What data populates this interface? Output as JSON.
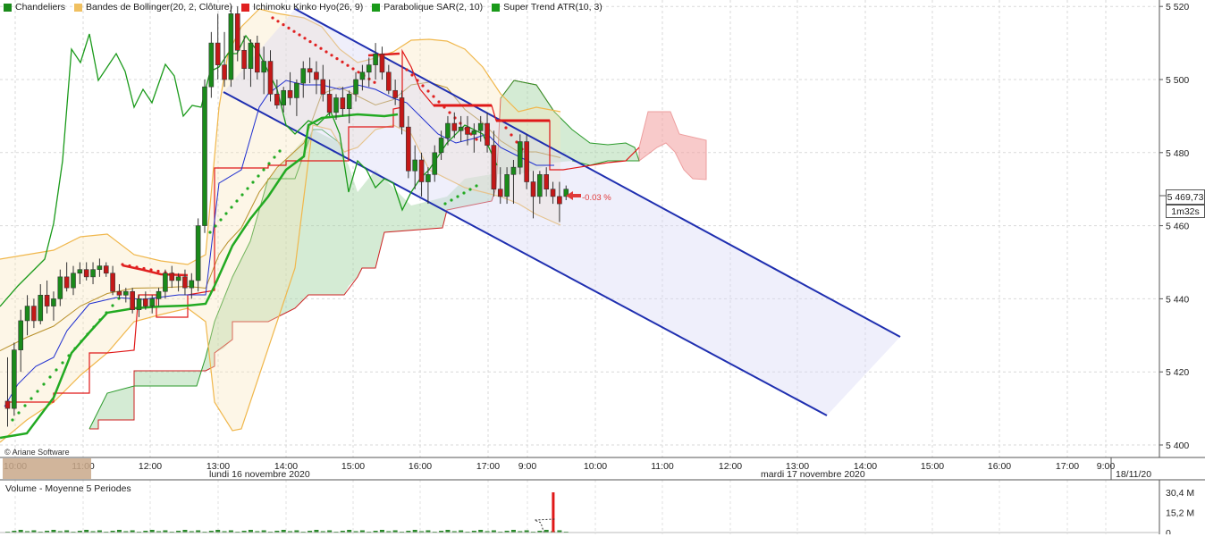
{
  "legend": [
    {
      "label": "Chandeliers",
      "color": "#1a8a1a"
    },
    {
      "label": "Bandes de Bollinger(20, 2, Clôture)",
      "color": "#f0c060"
    },
    {
      "label": "Ichimoku Kinko Hyo(26, 9)",
      "color": "#e02020"
    },
    {
      "label": "Parabolique SAR(2, 10)",
      "color": "#1a9a1a"
    },
    {
      "label": "Super Trend ATR(10, 3)",
      "color": "#1a9a1a"
    }
  ],
  "copyright": "© Ariane Software",
  "volume_title": "Volume  - Moyenne 5 Periodes",
  "last_price_box": "5 469,73",
  "timer_box": "1m32s",
  "change_label": "-0.03 %",
  "date_labels": {
    "day1": "lundi 16 novembre 2020",
    "day2": "mardi 17 novembre 2020",
    "day3": "18/11/20"
  },
  "chart_data": {
    "type": "candlestick",
    "y_axis": {
      "range": [
        5395,
        5525
      ],
      "ticks": [
        "5 400",
        "5 420",
        "5 440",
        "5 460",
        "5 480",
        "5 500",
        "5 520"
      ]
    },
    "x_ticks": [
      "10:00",
      "11:00",
      "12:00",
      "13:00",
      "14:00",
      "15:00",
      "16:00",
      "17:00",
      "9:00",
      "10:00",
      "11:00",
      "12:00",
      "13:00",
      "14:00",
      "15:00",
      "16:00",
      "17:00",
      "9:00"
    ],
    "volume_axis": {
      "ticks": [
        "30,4 M",
        "15,2 M",
        "0"
      ],
      "range": [
        0,
        30.4
      ]
    },
    "candles": [
      [
        5412,
        5424,
        5405,
        5410
      ],
      [
        5410,
        5428,
        5408,
        5426
      ],
      [
        5426,
        5437,
        5420,
        5434
      ],
      [
        5434,
        5441,
        5430,
        5438
      ],
      [
        5438,
        5440,
        5432,
        5434
      ],
      [
        5434,
        5444,
        5433,
        5441
      ],
      [
        5441,
        5445,
        5436,
        5438
      ],
      [
        5438,
        5442,
        5434,
        5440
      ],
      [
        5440,
        5448,
        5438,
        5446
      ],
      [
        5446,
        5450,
        5442,
        5443
      ],
      [
        5443,
        5449,
        5441,
        5447
      ],
      [
        5447,
        5450,
        5444,
        5448
      ],
      [
        5448,
        5450,
        5445,
        5446
      ],
      [
        5446,
        5450,
        5444,
        5448
      ],
      [
        5448,
        5451,
        5446,
        5449
      ],
      [
        5449,
        5450,
        5446,
        5447
      ],
      [
        5447,
        5449,
        5441,
        5442
      ],
      [
        5442,
        5444,
        5440,
        5441
      ],
      [
        5441,
        5443,
        5439,
        5442
      ],
      [
        5442,
        5443,
        5436,
        5437
      ],
      [
        5437,
        5441,
        5435,
        5440
      ],
      [
        5440,
        5442,
        5437,
        5438
      ],
      [
        5438,
        5441,
        5436,
        5440
      ],
      [
        5440,
        5443,
        5438,
        5442
      ],
      [
        5442,
        5448,
        5440,
        5447
      ],
      [
        5447,
        5449,
        5443,
        5445
      ],
      [
        5445,
        5447,
        5442,
        5446
      ],
      [
        5446,
        5448,
        5441,
        5443
      ],
      [
        5443,
        5447,
        5440,
        5445
      ],
      [
        5445,
        5462,
        5442,
        5460
      ],
      [
        5460,
        5500,
        5458,
        5498
      ],
      [
        5498,
        5513,
        5495,
        5510
      ],
      [
        5510,
        5518,
        5500,
        5504
      ],
      [
        5504,
        5513,
        5498,
        5500
      ],
      [
        5500,
        5520,
        5498,
        5518
      ],
      [
        5518,
        5520,
        5505,
        5508
      ],
      [
        5508,
        5512,
        5500,
        5503
      ],
      [
        5503,
        5511,
        5498,
        5510
      ],
      [
        5510,
        5512,
        5500,
        5502
      ],
      [
        5502,
        5509,
        5496,
        5505
      ],
      [
        5505,
        5508,
        5494,
        5496
      ],
      [
        5496,
        5500,
        5492,
        5493
      ],
      [
        5493,
        5498,
        5491,
        5497
      ],
      [
        5497,
        5502,
        5493,
        5495
      ],
      [
        5495,
        5500,
        5490,
        5499
      ],
      [
        5499,
        5505,
        5495,
        5503
      ],
      [
        5503,
        5506,
        5499,
        5502
      ],
      [
        5502,
        5505,
        5496,
        5500
      ],
      [
        5500,
        5504,
        5494,
        5496
      ],
      [
        5496,
        5500,
        5490,
        5491
      ],
      [
        5491,
        5496,
        5489,
        5495
      ],
      [
        5495,
        5498,
        5490,
        5492
      ],
      [
        5492,
        5497,
        5488,
        5496
      ],
      [
        5496,
        5502,
        5494,
        5500
      ],
      [
        5500,
        5504,
        5497,
        5502
      ],
      [
        5502,
        5506,
        5498,
        5504
      ],
      [
        5504,
        5510,
        5500,
        5507
      ],
      [
        5507,
        5509,
        5500,
        5502
      ],
      [
        5502,
        5504,
        5496,
        5497
      ],
      [
        5497,
        5500,
        5493,
        5495
      ],
      [
        5495,
        5497,
        5485,
        5487
      ],
      [
        5487,
        5490,
        5473,
        5475
      ],
      [
        5475,
        5482,
        5470,
        5478
      ],
      [
        5478,
        5480,
        5468,
        5472
      ],
      [
        5472,
        5476,
        5466,
        5474
      ],
      [
        5474,
        5482,
        5472,
        5480
      ],
      [
        5480,
        5486,
        5478,
        5484
      ],
      [
        5484,
        5490,
        5482,
        5488
      ],
      [
        5488,
        5491,
        5484,
        5486
      ],
      [
        5486,
        5490,
        5483,
        5487
      ],
      [
        5487,
        5490,
        5482,
        5485
      ],
      [
        5485,
        5488,
        5480,
        5486
      ],
      [
        5486,
        5490,
        5483,
        5488
      ],
      [
        5488,
        5491,
        5480,
        5482
      ],
      [
        5482,
        5486,
        5468,
        5470
      ],
      [
        5470,
        5476,
        5466,
        5468
      ],
      [
        5468,
        5476,
        5466,
        5474
      ],
      [
        5474,
        5478,
        5466,
        5476
      ],
      [
        5476,
        5485,
        5474,
        5483
      ],
      [
        5483,
        5485,
        5470,
        5472
      ],
      [
        5472,
        5475,
        5462,
        5468
      ],
      [
        5468,
        5475,
        5466,
        5474
      ],
      [
        5474,
        5476,
        5468,
        5470
      ],
      [
        5470,
        5472,
        5466,
        5468
      ],
      [
        5468,
        5472,
        5461,
        5466
      ],
      [
        5468,
        5471,
        5467,
        5470
      ]
    ],
    "volume": {
      "spike_index": 84,
      "spike_value": 30.4
    }
  }
}
